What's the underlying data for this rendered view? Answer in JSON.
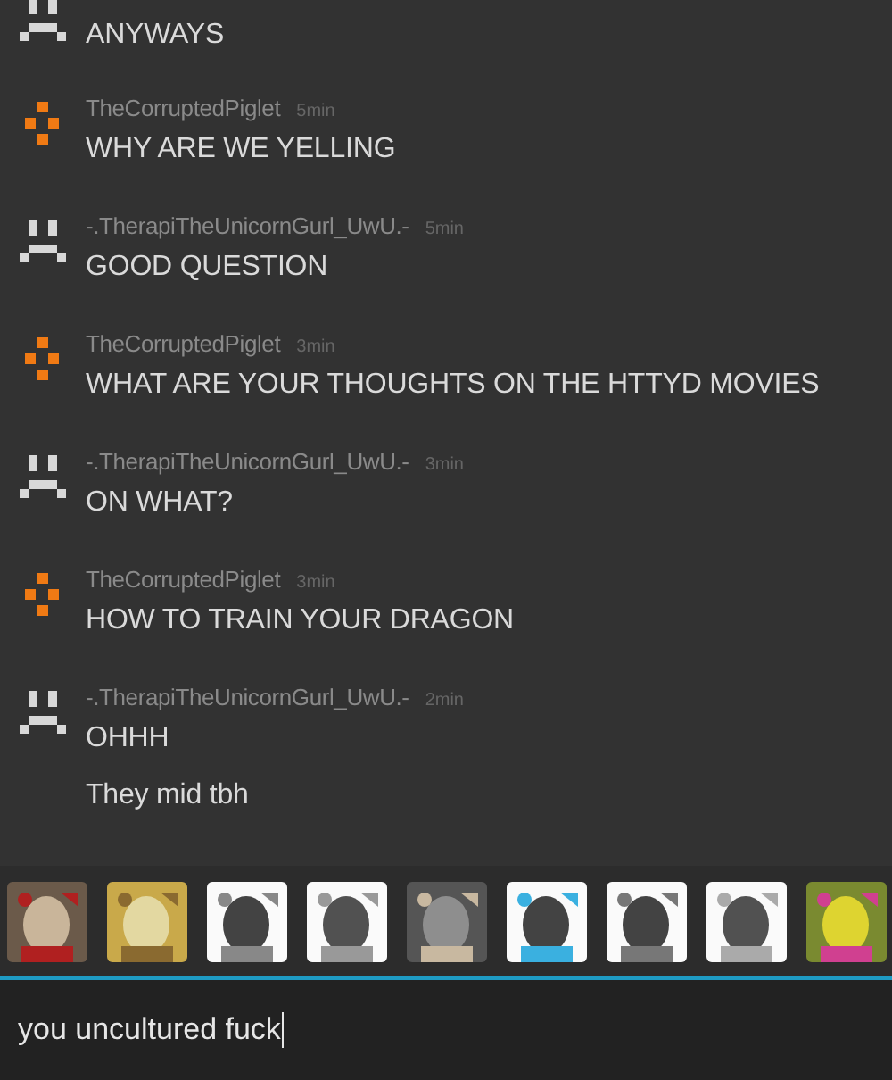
{
  "messages": [
    {
      "kind": "frown",
      "lines": [
        "ANYWAYS"
      ]
    },
    {
      "kind": "cross",
      "author": "TheCorruptedPiglet",
      "time": "5min",
      "lines": [
        "WHY ARE WE YELLING"
      ]
    },
    {
      "kind": "frown",
      "author": "-.TherapiTheUnicornGurl_UwU.-",
      "time": "5min",
      "lines": [
        "GOOD QUESTION"
      ]
    },
    {
      "kind": "cross",
      "author": "TheCorruptedPiglet",
      "time": "3min",
      "lines": [
        "WHAT ARE YOUR THOUGHTS ON THE HTTYD MOVIES"
      ]
    },
    {
      "kind": "frown",
      "author": "-.TherapiTheUnicornGurl_UwU.-",
      "time": "3min",
      "lines": [
        "ON WHAT?"
      ]
    },
    {
      "kind": "cross",
      "author": "TheCorruptedPiglet",
      "time": "3min",
      "lines": [
        "HOW TO TRAIN YOUR DRAGON"
      ]
    },
    {
      "kind": "frown",
      "author": "-.TherapiTheUnicornGurl_UwU.-",
      "time": "2min",
      "lines": [
        "OHHH",
        "They mid tbh"
      ]
    }
  ],
  "composer": {
    "value": "you uncultured fuck"
  }
}
